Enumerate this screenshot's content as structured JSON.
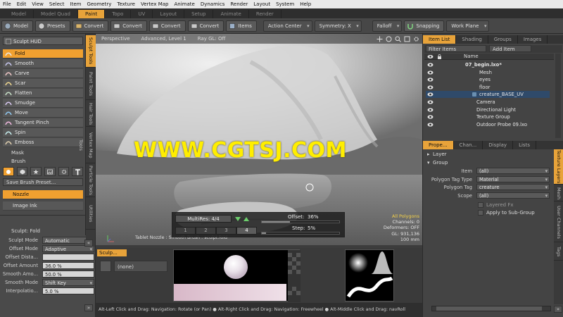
{
  "menu": [
    "File",
    "Edit",
    "View",
    "Select",
    "Item",
    "Geometry",
    "Texture",
    "Vertex Map",
    "Animate",
    "Dynamics",
    "Render",
    "Layout",
    "System",
    "Help"
  ],
  "layout_tabs": [
    {
      "label": "Model",
      "active": false
    },
    {
      "label": "Model Quad",
      "active": false
    },
    {
      "label": "Paint",
      "active": true
    },
    {
      "label": "Topo",
      "active": false
    },
    {
      "label": "UV",
      "active": false
    },
    {
      "label": "Layout",
      "active": false
    },
    {
      "label": "Setup",
      "active": false
    },
    {
      "label": "Animate",
      "active": false
    },
    {
      "label": "Render",
      "active": false
    }
  ],
  "toolbar": {
    "model": "Model",
    "presets": "Presets",
    "convert1": "Convert",
    "convert2": "Convert",
    "convert3": "Convert",
    "convert4": "Convert",
    "items": "Items",
    "action_center": "Action Center",
    "symmetry": "Symmetry: X",
    "falloff": "Falloff",
    "snapping": "Snapping",
    "work_plane": "Work Plane"
  },
  "left": {
    "hud_btn": "Sculpt HUD",
    "tools": [
      "Fold",
      "Smooth",
      "Carve",
      "Scar",
      "Flatten",
      "Smudge",
      "Move",
      "Tangent Pinch",
      "Spin",
      "Emboss"
    ],
    "active_tool": "Fold",
    "mask": "Mask",
    "brush": "Brush",
    "save_brush": "Save Brush Preset...",
    "nozzle": "Nozzle",
    "image_ink": "Image Ink",
    "vertical_tabs": [
      "Sculpt Tools",
      "Paint Tools",
      "Hair Tools",
      "Vertex Map Tools",
      "Particle Tools",
      "Utilities"
    ],
    "sculpt_header": "Sculpt: Fold",
    "props": [
      {
        "label": "Sculpt Mode",
        "value": "Automatic",
        "kind": "dd"
      },
      {
        "label": "Offset Mode",
        "value": "Adaptive",
        "kind": "dd"
      },
      {
        "label": "Offset Dista...",
        "value": "",
        "kind": "num"
      },
      {
        "label": "Offset Amount",
        "value": "36.0 %",
        "kind": "num"
      },
      {
        "label": "Smooth Amo...",
        "value": "50.0 %",
        "kind": "num"
      },
      {
        "label": "Smooth Mode",
        "value": "Shift Key",
        "kind": "dd"
      },
      {
        "label": "Interpolatio...",
        "value": "5.0 %",
        "kind": "num"
      }
    ]
  },
  "viewport": {
    "header": [
      "Perspective",
      "Advanced, Level 1",
      "Ray GL: Off"
    ],
    "nozzle_label": "Tablet Nozzle : Smooth Brush : sculpt.fold",
    "info": {
      "all_polygons": "All Polygons",
      "channels": "Channels: 0",
      "deformers": "Deformers: OFF",
      "gl": "GL: 931,136",
      "scale": "100 mm"
    },
    "hud": {
      "multires": "MultiRes: 4/4",
      "levels": [
        "1",
        "2",
        "3",
        "4"
      ],
      "offset_label": "Offset:",
      "offset_value": "36%",
      "step_label": "Step:",
      "step_value": "5%"
    }
  },
  "watermark": "WWW.CGTSJ.COM",
  "right": {
    "top_tabs": [
      "Item List",
      "Shading",
      "Groups",
      "Images"
    ],
    "filter": "Filter Items",
    "add_item": "Add Item",
    "name_col": "Name",
    "items": [
      {
        "name": "07_begin.lxo*",
        "indent": 56,
        "bold": true,
        "selected": false,
        "swatch": ""
      },
      {
        "name": "Mesh",
        "indent": 76,
        "bold": false,
        "selected": false,
        "swatch": ""
      },
      {
        "name": "eyes",
        "indent": 76,
        "bold": false,
        "selected": false,
        "swatch": ""
      },
      {
        "name": "floor",
        "indent": 76,
        "bold": false,
        "selected": false,
        "swatch": ""
      },
      {
        "name": "creature_BASE_UV",
        "indent": 76,
        "bold": false,
        "selected": true,
        "swatch": "#6a8fb0"
      },
      {
        "name": "Camera",
        "indent": 72,
        "bold": false,
        "selected": false,
        "swatch": ""
      },
      {
        "name": "Directional Light",
        "indent": 72,
        "bold": false,
        "selected": false,
        "swatch": ""
      },
      {
        "name": "Texture Group",
        "indent": 72,
        "bold": false,
        "selected": false,
        "swatch": ""
      },
      {
        "name": "Outdoor Probe 09.lxo",
        "indent": 72,
        "bold": false,
        "selected": false,
        "swatch": ""
      }
    ],
    "bottom_tabs": [
      "Prope...",
      "Chan...",
      "Display",
      "Lists"
    ],
    "layer": "Layer",
    "group": "Group",
    "props": [
      {
        "label": "Item",
        "value": "(all)"
      },
      {
        "label": "Polygon Tag Type",
        "value": "Material"
      },
      {
        "label": "Polygon Tag",
        "value": "creature"
      },
      {
        "label": "Scope",
        "value": "(all)"
      }
    ],
    "layered_fx": "Layered Fx",
    "apply_sub": "Apply to Sub-Group",
    "side_tabs": [
      "Texture Layers",
      "Mesh",
      "User Channels",
      "Tags"
    ]
  },
  "bottom": {
    "tab": "Sculp...",
    "none": "(none)"
  },
  "status": "Alt-Left Click and Drag: Navigation: Rotate (or Pan) ● Alt-Right Click and Drag: Navigation: Freewheel ● Alt-Middle Click and Drag: navRoll",
  "colors": {
    "accent": "#e8a33a",
    "watermark": "#ffee00"
  }
}
